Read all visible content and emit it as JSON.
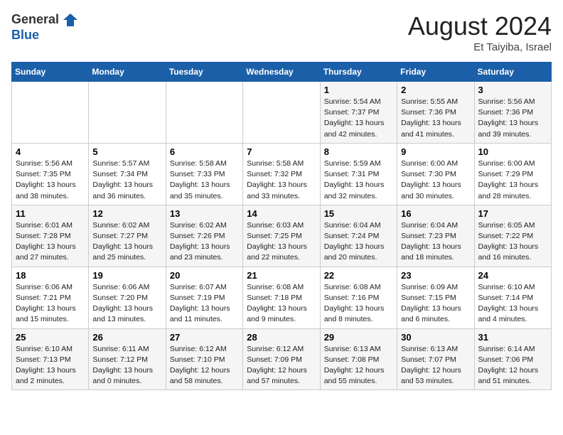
{
  "logo": {
    "general": "General",
    "blue": "Blue"
  },
  "title": "August 2024",
  "location": "Et Taiyiba, Israel",
  "days_of_week": [
    "Sunday",
    "Monday",
    "Tuesday",
    "Wednesday",
    "Thursday",
    "Friday",
    "Saturday"
  ],
  "weeks": [
    [
      {
        "day": "",
        "info": ""
      },
      {
        "day": "",
        "info": ""
      },
      {
        "day": "",
        "info": ""
      },
      {
        "day": "",
        "info": ""
      },
      {
        "day": "1",
        "info": "Sunrise: 5:54 AM\nSunset: 7:37 PM\nDaylight: 13 hours\nand 42 minutes."
      },
      {
        "day": "2",
        "info": "Sunrise: 5:55 AM\nSunset: 7:36 PM\nDaylight: 13 hours\nand 41 minutes."
      },
      {
        "day": "3",
        "info": "Sunrise: 5:56 AM\nSunset: 7:36 PM\nDaylight: 13 hours\nand 39 minutes."
      }
    ],
    [
      {
        "day": "4",
        "info": "Sunrise: 5:56 AM\nSunset: 7:35 PM\nDaylight: 13 hours\nand 38 minutes."
      },
      {
        "day": "5",
        "info": "Sunrise: 5:57 AM\nSunset: 7:34 PM\nDaylight: 13 hours\nand 36 minutes."
      },
      {
        "day": "6",
        "info": "Sunrise: 5:58 AM\nSunset: 7:33 PM\nDaylight: 13 hours\nand 35 minutes."
      },
      {
        "day": "7",
        "info": "Sunrise: 5:58 AM\nSunset: 7:32 PM\nDaylight: 13 hours\nand 33 minutes."
      },
      {
        "day": "8",
        "info": "Sunrise: 5:59 AM\nSunset: 7:31 PM\nDaylight: 13 hours\nand 32 minutes."
      },
      {
        "day": "9",
        "info": "Sunrise: 6:00 AM\nSunset: 7:30 PM\nDaylight: 13 hours\nand 30 minutes."
      },
      {
        "day": "10",
        "info": "Sunrise: 6:00 AM\nSunset: 7:29 PM\nDaylight: 13 hours\nand 28 minutes."
      }
    ],
    [
      {
        "day": "11",
        "info": "Sunrise: 6:01 AM\nSunset: 7:28 PM\nDaylight: 13 hours\nand 27 minutes."
      },
      {
        "day": "12",
        "info": "Sunrise: 6:02 AM\nSunset: 7:27 PM\nDaylight: 13 hours\nand 25 minutes."
      },
      {
        "day": "13",
        "info": "Sunrise: 6:02 AM\nSunset: 7:26 PM\nDaylight: 13 hours\nand 23 minutes."
      },
      {
        "day": "14",
        "info": "Sunrise: 6:03 AM\nSunset: 7:25 PM\nDaylight: 13 hours\nand 22 minutes."
      },
      {
        "day": "15",
        "info": "Sunrise: 6:04 AM\nSunset: 7:24 PM\nDaylight: 13 hours\nand 20 minutes."
      },
      {
        "day": "16",
        "info": "Sunrise: 6:04 AM\nSunset: 7:23 PM\nDaylight: 13 hours\nand 18 minutes."
      },
      {
        "day": "17",
        "info": "Sunrise: 6:05 AM\nSunset: 7:22 PM\nDaylight: 13 hours\nand 16 minutes."
      }
    ],
    [
      {
        "day": "18",
        "info": "Sunrise: 6:06 AM\nSunset: 7:21 PM\nDaylight: 13 hours\nand 15 minutes."
      },
      {
        "day": "19",
        "info": "Sunrise: 6:06 AM\nSunset: 7:20 PM\nDaylight: 13 hours\nand 13 minutes."
      },
      {
        "day": "20",
        "info": "Sunrise: 6:07 AM\nSunset: 7:19 PM\nDaylight: 13 hours\nand 11 minutes."
      },
      {
        "day": "21",
        "info": "Sunrise: 6:08 AM\nSunset: 7:18 PM\nDaylight: 13 hours\nand 9 minutes."
      },
      {
        "day": "22",
        "info": "Sunrise: 6:08 AM\nSunset: 7:16 PM\nDaylight: 13 hours\nand 8 minutes."
      },
      {
        "day": "23",
        "info": "Sunrise: 6:09 AM\nSunset: 7:15 PM\nDaylight: 13 hours\nand 6 minutes."
      },
      {
        "day": "24",
        "info": "Sunrise: 6:10 AM\nSunset: 7:14 PM\nDaylight: 13 hours\nand 4 minutes."
      }
    ],
    [
      {
        "day": "25",
        "info": "Sunrise: 6:10 AM\nSunset: 7:13 PM\nDaylight: 13 hours\nand 2 minutes."
      },
      {
        "day": "26",
        "info": "Sunrise: 6:11 AM\nSunset: 7:12 PM\nDaylight: 13 hours\nand 0 minutes."
      },
      {
        "day": "27",
        "info": "Sunrise: 6:12 AM\nSunset: 7:10 PM\nDaylight: 12 hours\nand 58 minutes."
      },
      {
        "day": "28",
        "info": "Sunrise: 6:12 AM\nSunset: 7:09 PM\nDaylight: 12 hours\nand 57 minutes."
      },
      {
        "day": "29",
        "info": "Sunrise: 6:13 AM\nSunset: 7:08 PM\nDaylight: 12 hours\nand 55 minutes."
      },
      {
        "day": "30",
        "info": "Sunrise: 6:13 AM\nSunset: 7:07 PM\nDaylight: 12 hours\nand 53 minutes."
      },
      {
        "day": "31",
        "info": "Sunrise: 6:14 AM\nSunset: 7:06 PM\nDaylight: 12 hours\nand 51 minutes."
      }
    ]
  ]
}
